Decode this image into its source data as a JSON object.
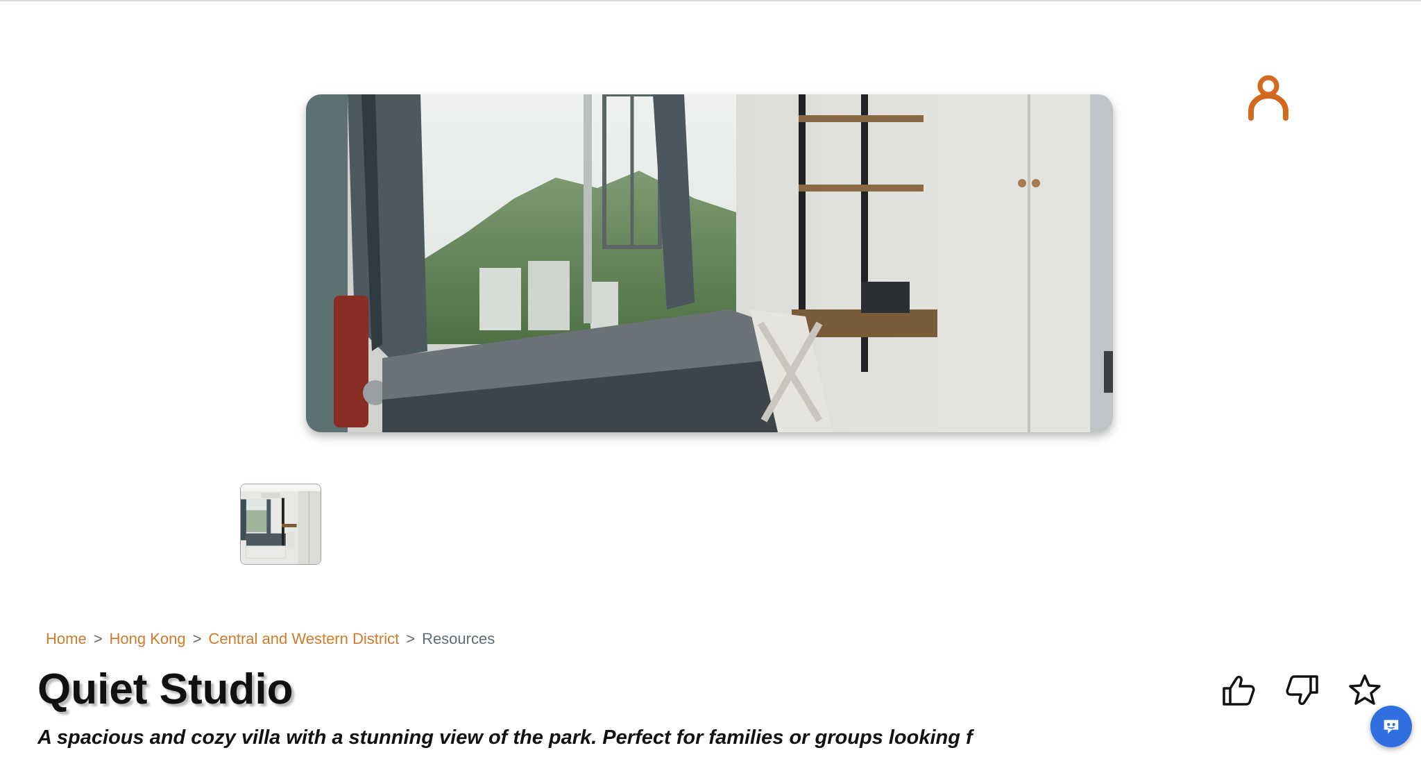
{
  "listing": {
    "title": "Quiet Studio",
    "description": "A spacious and cozy villa with a stunning view of the park. Perfect for families or groups looking f"
  },
  "breadcrumb": {
    "home": "Home",
    "region": "Hong Kong",
    "district": "Central and Western District",
    "current": "Resources",
    "separator": ">"
  },
  "icons": {
    "user": "user-icon",
    "like": "thumbs-up-icon",
    "dislike": "thumbs-down-icon",
    "favorite": "star-icon",
    "chat": "chat-bot-icon"
  },
  "colors": {
    "accent": "#d2691e",
    "link": "#d27a2c",
    "chat": "#2f6fe0"
  }
}
